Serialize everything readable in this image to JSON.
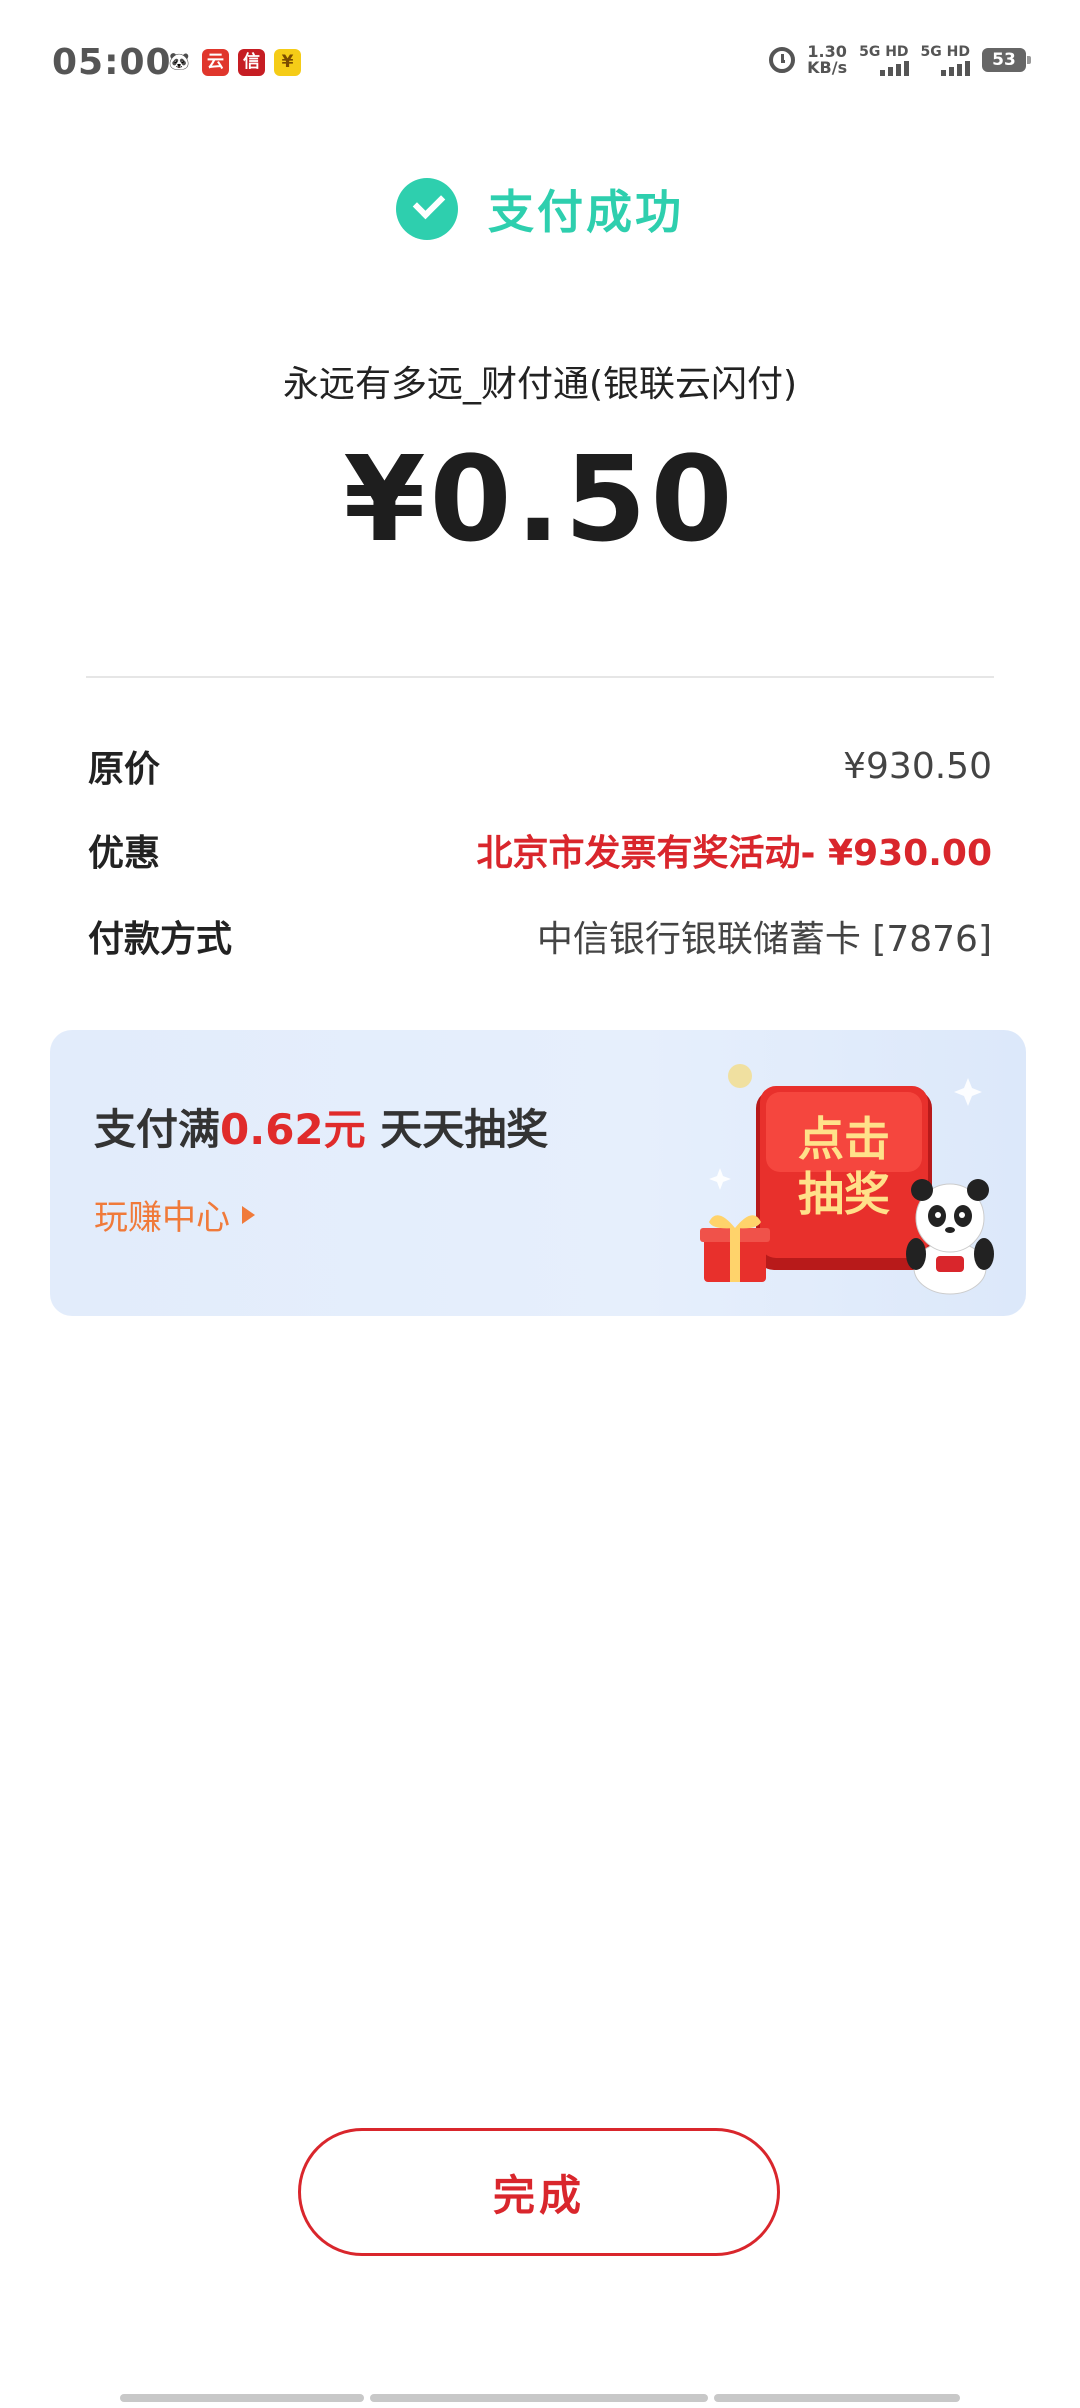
{
  "status_bar": {
    "time": "05:00",
    "notification_icons": [
      {
        "name": "panda-app-icon",
        "glyph": "🐼"
      },
      {
        "name": "unionpay-app-icon",
        "glyph": "云"
      },
      {
        "name": "citic-bank-app-icon",
        "glyph": "信"
      },
      {
        "name": "yen-app-icon",
        "glyph": "¥"
      }
    ],
    "net_speed_value": "1.30",
    "net_speed_unit": "KB/s",
    "signal_1_label": "5G HD",
    "signal_2_label": "5G HD",
    "battery": "53"
  },
  "header": {
    "success_text": "支付成功",
    "success_color": "#2ecfae"
  },
  "payment": {
    "merchant": "永远有多远_财付通(银联云闪付)",
    "amount": "¥0.50"
  },
  "details": {
    "original_price_label": "原价",
    "original_price_value": "¥930.50",
    "discount_label": "优惠",
    "discount_value": "北京市发票有奖活动- ¥930.00",
    "method_label": "付款方式",
    "method_value": "中信银行银联储蓄卡 [7876]"
  },
  "promo": {
    "title_prefix": "支付满",
    "title_highlight": "0.62元",
    "title_suffix": " 天天抽奖",
    "link_label": "玩赚中心",
    "button_line_1": "点击",
    "button_line_2": "抽奖"
  },
  "actions": {
    "done_label": "完成"
  },
  "colors": {
    "accent_red": "#d9262c",
    "accent_green": "#2ecfae",
    "promo_orange": "#f07a3a",
    "promo_bg": "#e2ecfb"
  }
}
